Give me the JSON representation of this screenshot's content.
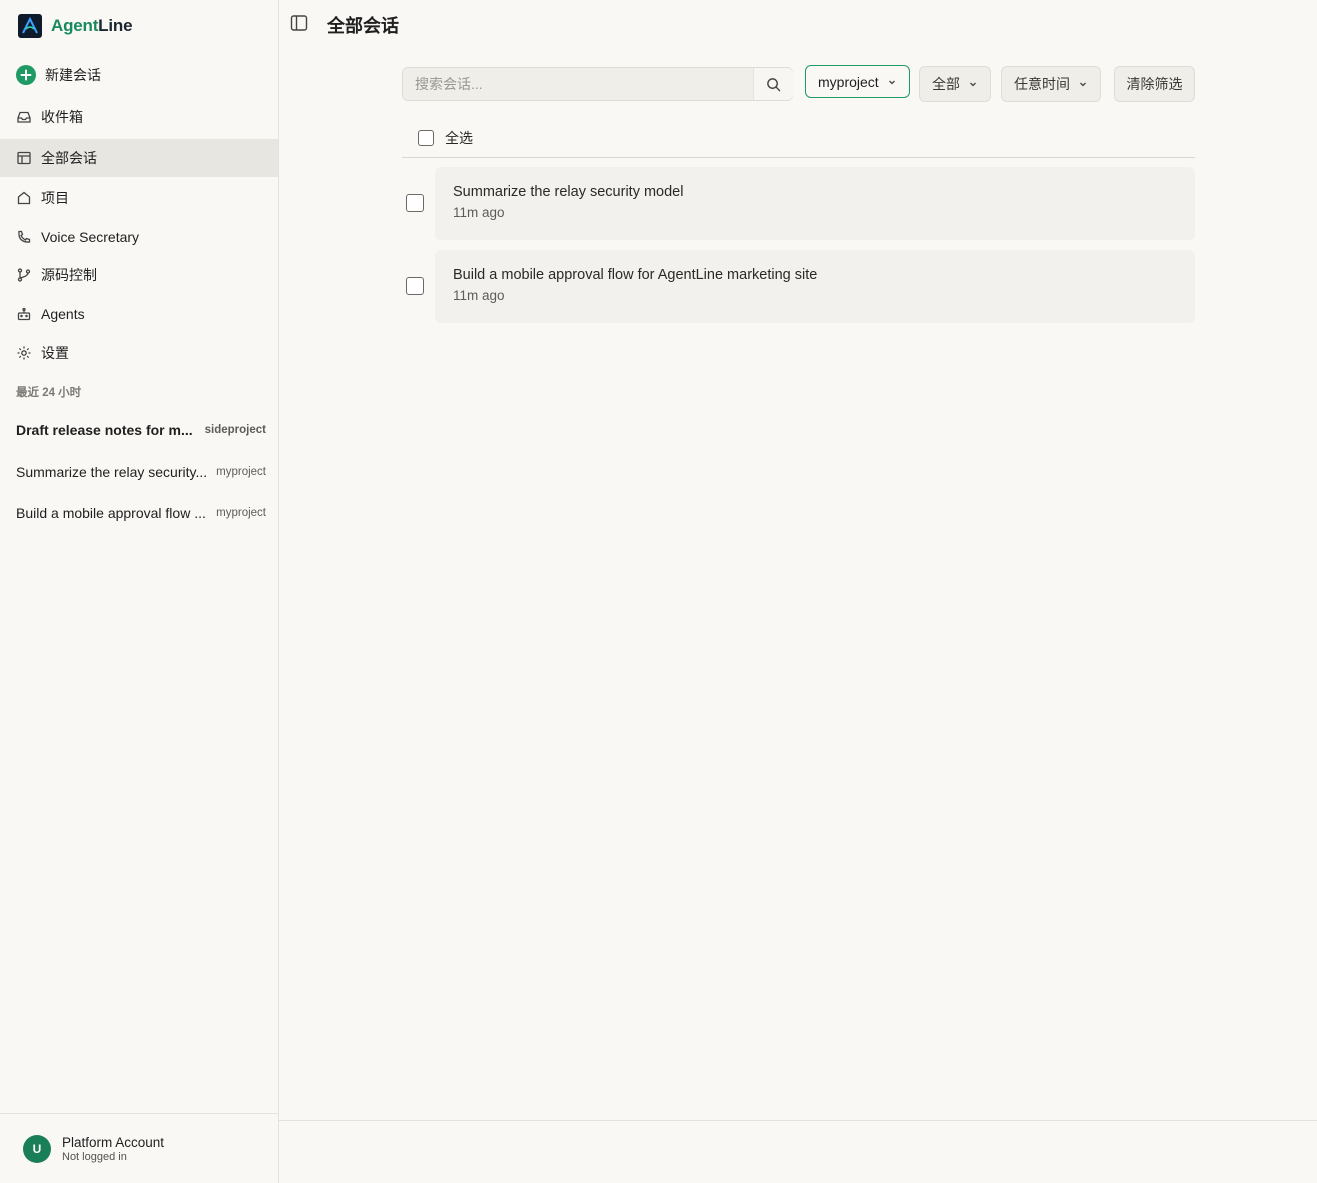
{
  "app": {
    "brand_part1": "Agent",
    "brand_part2": "Line",
    "colors": {
      "accent": "#1f9a64",
      "brand_green": "#1a8a5e",
      "active_bg": "#e8e6e1"
    }
  },
  "sidebar": {
    "new_chat": "新建会话",
    "nav": [
      {
        "label": "收件箱",
        "icon": "inbox-icon"
      },
      {
        "label": "全部会话",
        "icon": "layout-icon",
        "active": true
      },
      {
        "label": "项目",
        "icon": "home-icon"
      },
      {
        "label": "Voice Secretary",
        "icon": "phone-icon"
      },
      {
        "label": "源码控制",
        "icon": "git-branch-icon"
      },
      {
        "label": "Agents",
        "icon": "robot-icon"
      },
      {
        "label": "设置",
        "icon": "gear-icon"
      }
    ],
    "recent_label": "最近 24 小时",
    "recent": [
      {
        "title": "Draft release notes for m...",
        "project": "sideproject",
        "bold": true
      },
      {
        "title": "Summarize the relay security...",
        "project": "myproject"
      },
      {
        "title": "Build a mobile approval flow ...",
        "project": "myproject"
      }
    ],
    "account": {
      "initial": "U",
      "name": "Platform Account",
      "status": "Not logged in"
    }
  },
  "main": {
    "title": "全部会话",
    "search": {
      "placeholder": "搜索会话..."
    },
    "filters": {
      "project": "myproject",
      "status": "全部",
      "time": "任意时间",
      "clear": "清除筛选"
    },
    "select_all": "全选",
    "sessions": [
      {
        "title": "Summarize the relay security model",
        "time": "11m ago"
      },
      {
        "title": "Build a mobile approval flow for AgentLine marketing site",
        "time": "11m ago"
      }
    ]
  }
}
